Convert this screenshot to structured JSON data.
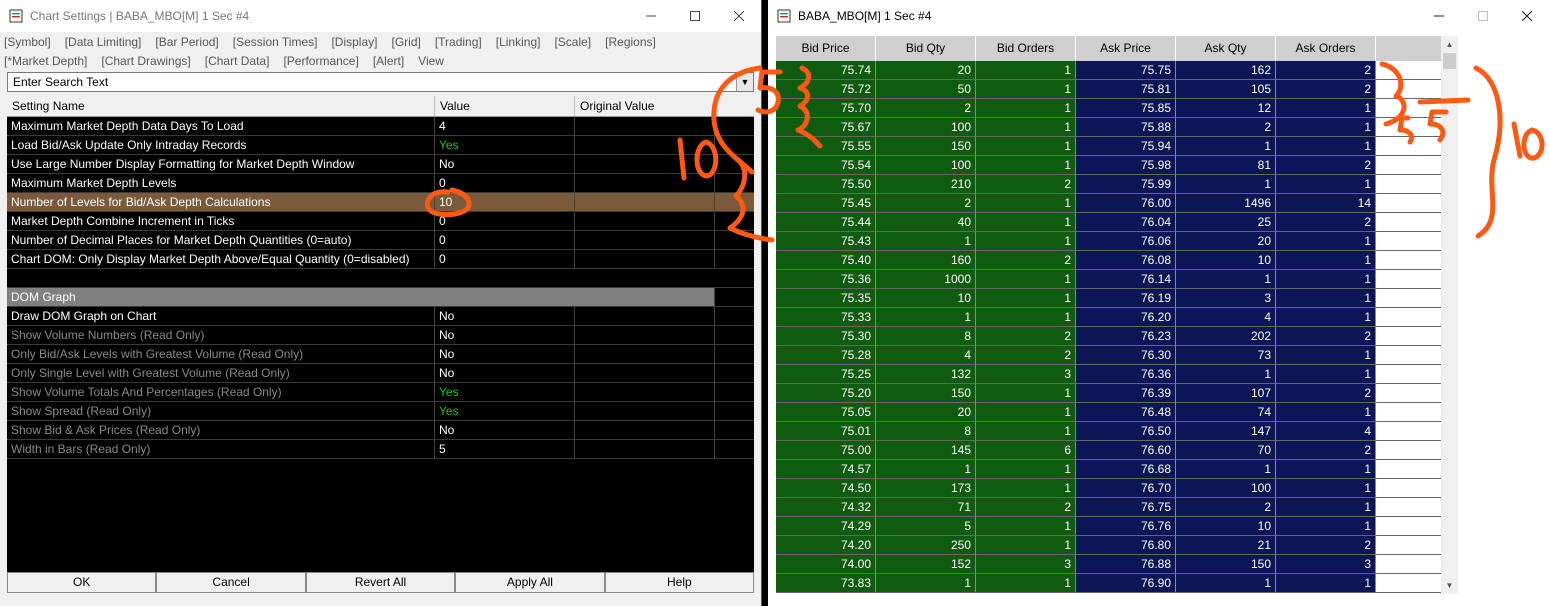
{
  "left_window": {
    "title": "Chart Settings | BABA_MBO[M]  1 Sec  #4",
    "tabs_row1": [
      "[Symbol]",
      "[Data Limiting]",
      "[Bar Period]",
      "[Session Times]",
      "[Display]",
      "[Grid]",
      "[Trading]",
      "[Linking]",
      "[Scale]",
      "[Regions]"
    ],
    "tabs_row2": [
      "[*Market Depth]",
      "[Chart Drawings]",
      "[Chart Data]",
      "[Performance]",
      "[Alert]",
      "View"
    ],
    "search": {
      "placeholder": "Enter Search Text",
      "value": "Enter Search Text"
    },
    "columns": [
      "Setting Name",
      "Value",
      "Original Value"
    ],
    "settings": [
      {
        "name": "Maximum Market Depth Data Days To Load",
        "value": "4"
      },
      {
        "name": "Load Bid/Ask Update Only Intraday Records",
        "value": "Yes"
      },
      {
        "name": "Use Large Number Display Formatting for Market Depth Window",
        "value": "No"
      },
      {
        "name": "Maximum Market Depth Levels",
        "value": "0"
      },
      {
        "name": "Number of Levels for Bid/Ask Depth Calculations",
        "value": "10"
      },
      {
        "name": "Market Depth Combine Increment in Ticks",
        "value": "0"
      },
      {
        "name": "Number of Decimal Places for Market Depth Quantities (0=auto)",
        "value": "0"
      },
      {
        "name": "Chart DOM: Only Display Market Depth Above/Equal Quantity (0=disabled)",
        "value": "0"
      }
    ],
    "section_title": "DOM Graph",
    "dom_settings": [
      {
        "name": "Draw DOM Graph on Chart",
        "value": "No"
      },
      {
        "name": "Show Volume Numbers (Read Only)",
        "value": "No"
      },
      {
        "name": "Only Bid/Ask Levels with Greatest Volume (Read Only)",
        "value": "No"
      },
      {
        "name": "Only Single Level with Greatest Volume (Read Only)",
        "value": "No"
      },
      {
        "name": "Show Volume Totals And Percentages (Read Only)",
        "value": "Yes"
      },
      {
        "name": "Show Spread (Read Only)",
        "value": "Yes"
      },
      {
        "name": "Show Bid & Ask Prices (Read Only)",
        "value": "No"
      },
      {
        "name": "Width in Bars (Read Only)",
        "value": "5"
      }
    ],
    "buttons": [
      "OK",
      "Cancel",
      "Revert All",
      "Apply All",
      "Help"
    ]
  },
  "right_window": {
    "title": "BABA_MBO[M]  1 Sec  #4",
    "columns": [
      "Bid Price",
      "Bid Qty",
      "Bid Orders",
      "Ask Price",
      "Ask Qty",
      "Ask Orders"
    ],
    "rows": [
      [
        "75.74",
        "20",
        "1",
        "75.75",
        "162",
        "2"
      ],
      [
        "75.72",
        "50",
        "1",
        "75.81",
        "105",
        "2"
      ],
      [
        "75.70",
        "2",
        "1",
        "75.85",
        "12",
        "1"
      ],
      [
        "75.67",
        "100",
        "1",
        "75.88",
        "2",
        "1"
      ],
      [
        "75.55",
        "150",
        "1",
        "75.94",
        "1",
        "1"
      ],
      [
        "75.54",
        "100",
        "1",
        "75.98",
        "81",
        "2"
      ],
      [
        "75.50",
        "210",
        "2",
        "75.99",
        "1",
        "1"
      ],
      [
        "75.45",
        "2",
        "1",
        "76.00",
        "1496",
        "14"
      ],
      [
        "75.44",
        "40",
        "1",
        "76.04",
        "25",
        "2"
      ],
      [
        "75.43",
        "1",
        "1",
        "76.06",
        "20",
        "1"
      ],
      [
        "75.40",
        "160",
        "2",
        "76.08",
        "10",
        "1"
      ],
      [
        "75.36",
        "1000",
        "1",
        "76.14",
        "1",
        "1"
      ],
      [
        "75.35",
        "10",
        "1",
        "76.19",
        "3",
        "1"
      ],
      [
        "75.33",
        "1",
        "1",
        "76.20",
        "4",
        "1"
      ],
      [
        "75.30",
        "8",
        "2",
        "76.23",
        "202",
        "2"
      ],
      [
        "75.28",
        "4",
        "2",
        "76.30",
        "73",
        "1"
      ],
      [
        "75.25",
        "132",
        "3",
        "76.36",
        "1",
        "1"
      ],
      [
        "75.20",
        "150",
        "1",
        "76.39",
        "107",
        "2"
      ],
      [
        "75.05",
        "20",
        "1",
        "76.48",
        "74",
        "1"
      ],
      [
        "75.01",
        "8",
        "1",
        "76.50",
        "147",
        "4"
      ],
      [
        "75.00",
        "145",
        "6",
        "76.60",
        "70",
        "2"
      ],
      [
        "74.57",
        "1",
        "1",
        "76.68",
        "1",
        "1"
      ],
      [
        "74.50",
        "173",
        "1",
        "76.70",
        "100",
        "1"
      ],
      [
        "74.32",
        "71",
        "2",
        "76.75",
        "2",
        "1"
      ],
      [
        "74.29",
        "5",
        "1",
        "76.76",
        "10",
        "1"
      ],
      [
        "74.20",
        "250",
        "1",
        "76.80",
        "21",
        "2"
      ],
      [
        "74.00",
        "152",
        "3",
        "76.88",
        "150",
        "3"
      ],
      [
        "73.83",
        "1",
        "1",
        "76.90",
        "1",
        "1"
      ]
    ]
  },
  "colors": {
    "bid": "#0f5b0f",
    "ask": "#0c1656",
    "annotation": "#ff5a14",
    "highlight_row": "#7a5a3a",
    "yes": "#18c818"
  },
  "icons": [
    "window-icon",
    "minimize-icon",
    "maximize-icon",
    "close-icon",
    "dropdown-icon",
    "scroll-up-icon",
    "scroll-down-icon"
  ]
}
